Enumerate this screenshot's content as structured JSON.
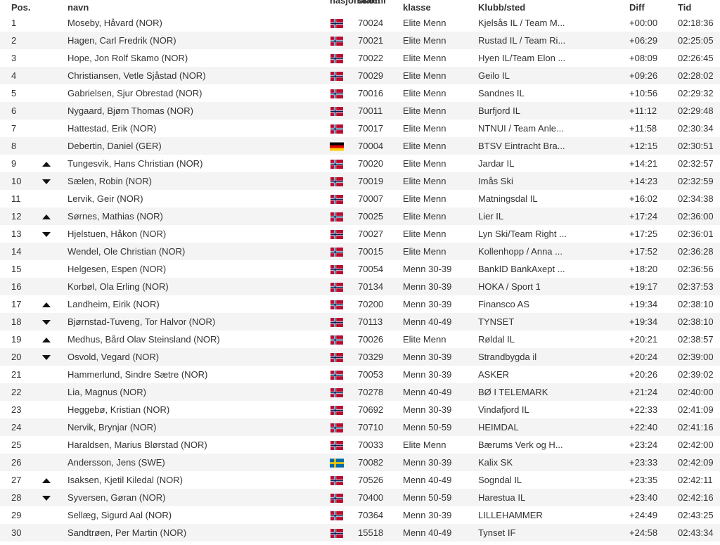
{
  "header": {
    "pos": "Pos.",
    "name": "navn",
    "nationality": "nasjonalitet",
    "startnr": "startnr",
    "class": "klasse",
    "club": "Klubb/sted",
    "diff": "Diff",
    "time": "Tid"
  },
  "flag_colors": {
    "NOR": {
      "red": "#ba0c2f",
      "white": "#ffffff",
      "blue": "#00205b"
    },
    "GER": {
      "black": "#000000",
      "red": "#dd0000",
      "gold": "#ffce00"
    },
    "SWE": {
      "blue": "#006aa7",
      "yellow": "#fecc00"
    }
  },
  "rows": [
    {
      "pos": "1",
      "trend": "",
      "name": "Moseby, Håvard (NOR)",
      "flag": "NOR",
      "start": "70024",
      "class": "Elite Menn",
      "club": "Kjelsås IL / Team M...",
      "diff": "+00:00",
      "time": "02:18:36"
    },
    {
      "pos": "2",
      "trend": "",
      "name": "Hagen, Carl Fredrik (NOR)",
      "flag": "NOR",
      "start": "70021",
      "class": "Elite Menn",
      "club": "Rustad IL / Team Ri...",
      "diff": "+06:29",
      "time": "02:25:05"
    },
    {
      "pos": "3",
      "trend": "",
      "name": "Hope, Jon Rolf Skamo (NOR)",
      "flag": "NOR",
      "start": "70022",
      "class": "Elite Menn",
      "club": "Hyen IL/Team Elon ...",
      "diff": "+08:09",
      "time": "02:26:45"
    },
    {
      "pos": "4",
      "trend": "",
      "name": "Christiansen, Vetle Sjåstad (NOR)",
      "flag": "NOR",
      "start": "70029",
      "class": "Elite Menn",
      "club": "Geilo IL",
      "diff": "+09:26",
      "time": "02:28:02"
    },
    {
      "pos": "5",
      "trend": "",
      "name": "Gabrielsen, Sjur Obrestad (NOR)",
      "flag": "NOR",
      "start": "70016",
      "class": "Elite Menn",
      "club": "Sandnes IL",
      "diff": "+10:56",
      "time": "02:29:32"
    },
    {
      "pos": "6",
      "trend": "",
      "name": "Nygaard, Bjørn Thomas (NOR)",
      "flag": "NOR",
      "start": "70011",
      "class": "Elite Menn",
      "club": "Burfjord IL",
      "diff": "+11:12",
      "time": "02:29:48"
    },
    {
      "pos": "7",
      "trend": "",
      "name": "Hattestad, Erik (NOR)",
      "flag": "NOR",
      "start": "70017",
      "class": "Elite Menn",
      "club": "NTNUI / Team Anle...",
      "diff": "+11:58",
      "time": "02:30:34"
    },
    {
      "pos": "8",
      "trend": "",
      "name": "Debertin, Daniel (GER)",
      "flag": "GER",
      "start": "70004",
      "class": "Elite Menn",
      "club": "BTSV Eintracht Bra...",
      "diff": "+12:15",
      "time": "02:30:51"
    },
    {
      "pos": "9",
      "trend": "up",
      "name": "Tungesvik, Hans Christian (NOR)",
      "flag": "NOR",
      "start": "70020",
      "class": "Elite Menn",
      "club": "Jardar IL",
      "diff": "+14:21",
      "time": "02:32:57"
    },
    {
      "pos": "10",
      "trend": "down",
      "name": "Sælen, Robin (NOR)",
      "flag": "NOR",
      "start": "70019",
      "class": "Elite Menn",
      "club": "Imås Ski",
      "diff": "+14:23",
      "time": "02:32:59"
    },
    {
      "pos": "11",
      "trend": "",
      "name": "Lervik, Geir (NOR)",
      "flag": "NOR",
      "start": "70007",
      "class": "Elite Menn",
      "club": "Matningsdal IL",
      "diff": "+16:02",
      "time": "02:34:38"
    },
    {
      "pos": "12",
      "trend": "up",
      "name": "Sørnes, Mathias (NOR)",
      "flag": "NOR",
      "start": "70025",
      "class": "Elite Menn",
      "club": "Lier IL",
      "diff": "+17:24",
      "time": "02:36:00"
    },
    {
      "pos": "13",
      "trend": "down",
      "name": "Hjelstuen, Håkon (NOR)",
      "flag": "NOR",
      "start": "70027",
      "class": "Elite Menn",
      "club": "Lyn Ski/Team Right ...",
      "diff": "+17:25",
      "time": "02:36:01"
    },
    {
      "pos": "14",
      "trend": "",
      "name": "Wendel, Ole Christian (NOR)",
      "flag": "NOR",
      "start": "70015",
      "class": "Elite Menn",
      "club": "Kollenhopp / Anna ...",
      "diff": "+17:52",
      "time": "02:36:28"
    },
    {
      "pos": "15",
      "trend": "",
      "name": "Helgesen, Espen (NOR)",
      "flag": "NOR",
      "start": "70054",
      "class": "Menn 30-39",
      "club": "BankID BankAxept ...",
      "diff": "+18:20",
      "time": "02:36:56"
    },
    {
      "pos": "16",
      "trend": "",
      "name": "Korbøl, Ola Erling (NOR)",
      "flag": "NOR",
      "start": "70134",
      "class": "Menn 30-39",
      "club": "HOKA / Sport 1",
      "diff": "+19:17",
      "time": "02:37:53"
    },
    {
      "pos": "17",
      "trend": "up",
      "name": "Landheim, Eirik (NOR)",
      "flag": "NOR",
      "start": "70200",
      "class": "Menn 30-39",
      "club": "Finansco AS",
      "diff": "+19:34",
      "time": "02:38:10"
    },
    {
      "pos": "18",
      "trend": "down",
      "name": "Bjørnstad-Tuveng, Tor Halvor (NOR)",
      "flag": "NOR",
      "start": "70113",
      "class": "Menn 40-49",
      "club": "TYNSET",
      "diff": "+19:34",
      "time": "02:38:10"
    },
    {
      "pos": "19",
      "trend": "up",
      "name": "Medhus, Bård Olav Steinsland (NOR)",
      "flag": "NOR",
      "start": "70026",
      "class": "Elite Menn",
      "club": "Røldal IL",
      "diff": "+20:21",
      "time": "02:38:57"
    },
    {
      "pos": "20",
      "trend": "down",
      "name": "Osvold, Vegard (NOR)",
      "flag": "NOR",
      "start": "70329",
      "class": "Menn 30-39",
      "club": "Strandbygda il",
      "diff": "+20:24",
      "time": "02:39:00"
    },
    {
      "pos": "21",
      "trend": "",
      "name": "Hammerlund, Sindre Sætre (NOR)",
      "flag": "NOR",
      "start": "70053",
      "class": "Menn 30-39",
      "club": "ASKER",
      "diff": "+20:26",
      "time": "02:39:02"
    },
    {
      "pos": "22",
      "trend": "",
      "name": "Lia, Magnus (NOR)",
      "flag": "NOR",
      "start": "70278",
      "class": "Menn 40-49",
      "club": "BØ I TELEMARK",
      "diff": "+21:24",
      "time": "02:40:00"
    },
    {
      "pos": "23",
      "trend": "",
      "name": "Heggebø, Kristian (NOR)",
      "flag": "NOR",
      "start": "70692",
      "class": "Menn 30-39",
      "club": "Vindafjord IL",
      "diff": "+22:33",
      "time": "02:41:09"
    },
    {
      "pos": "24",
      "trend": "",
      "name": "Nervik, Brynjar (NOR)",
      "flag": "NOR",
      "start": "70710",
      "class": "Menn 50-59",
      "club": "HEIMDAL",
      "diff": "+22:40",
      "time": "02:41:16"
    },
    {
      "pos": "25",
      "trend": "",
      "name": "Haraldsen, Marius Blørstad (NOR)",
      "flag": "NOR",
      "start": "70033",
      "class": "Elite Menn",
      "club": "Bærums Verk og H...",
      "diff": "+23:24",
      "time": "02:42:00"
    },
    {
      "pos": "26",
      "trend": "",
      "name": "Andersson, Jens (SWE)",
      "flag": "SWE",
      "start": "70082",
      "class": "Menn 30-39",
      "club": "Kalix SK",
      "diff": "+23:33",
      "time": "02:42:09"
    },
    {
      "pos": "27",
      "trend": "up",
      "name": "Isaksen, Kjetil Kiledal (NOR)",
      "flag": "NOR",
      "start": "70526",
      "class": "Menn 40-49",
      "club": "Sogndal IL",
      "diff": "+23:35",
      "time": "02:42:11"
    },
    {
      "pos": "28",
      "trend": "down",
      "name": "Syversen, Gøran (NOR)",
      "flag": "NOR",
      "start": "70400",
      "class": "Menn 50-59",
      "club": "Harestua IL",
      "diff": "+23:40",
      "time": "02:42:16"
    },
    {
      "pos": "29",
      "trend": "",
      "name": "Sellæg, Sigurd Aal (NOR)",
      "flag": "NOR",
      "start": "70364",
      "class": "Menn 30-39",
      "club": "LILLEHAMMER",
      "diff": "+24:49",
      "time": "02:43:25"
    },
    {
      "pos": "30",
      "trend": "",
      "name": "Sandtrøen, Per Martin (NOR)",
      "flag": "NOR",
      "start": "15518",
      "class": "Menn 40-49",
      "club": "Tynset IF",
      "diff": "+24:58",
      "time": "02:43:34"
    }
  ]
}
